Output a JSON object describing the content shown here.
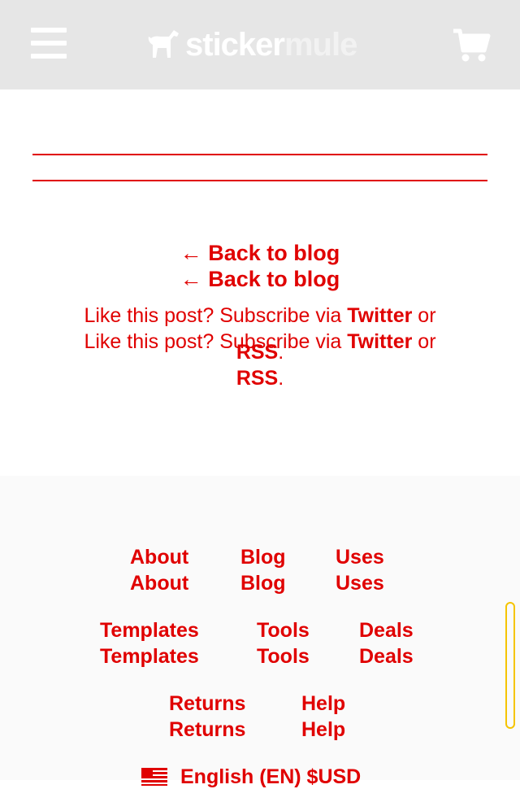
{
  "header": {
    "logo_part1": "sticker",
    "logo_part2": "mule",
    "menu_icon": "hamburger-menu-icon",
    "cart_icon": "shopping-cart-icon",
    "background": "#e6e6e6"
  },
  "post_nav": {
    "back_label": "← Back to blog",
    "subscribe_prefix": "Like this post? Subscribe via ",
    "twitter_label": "Twitter",
    "subscribe_or": " or",
    "rss_label": "RSS",
    "rss_period": "."
  },
  "footer": {
    "links": {
      "about": "About",
      "blog": "Blog",
      "uses": "Uses",
      "templates": "Templates",
      "tools": "Tools",
      "deals": "Deals",
      "returns": "Returns",
      "help": "Help"
    },
    "language": "English (EN) $USD",
    "flag_icon": "us-flag-icon"
  },
  "colors": {
    "accent": "#e00000",
    "header_bg": "#e6e6e6",
    "footer_bg": "#fafafa",
    "scrollbar": "#f5c400"
  }
}
